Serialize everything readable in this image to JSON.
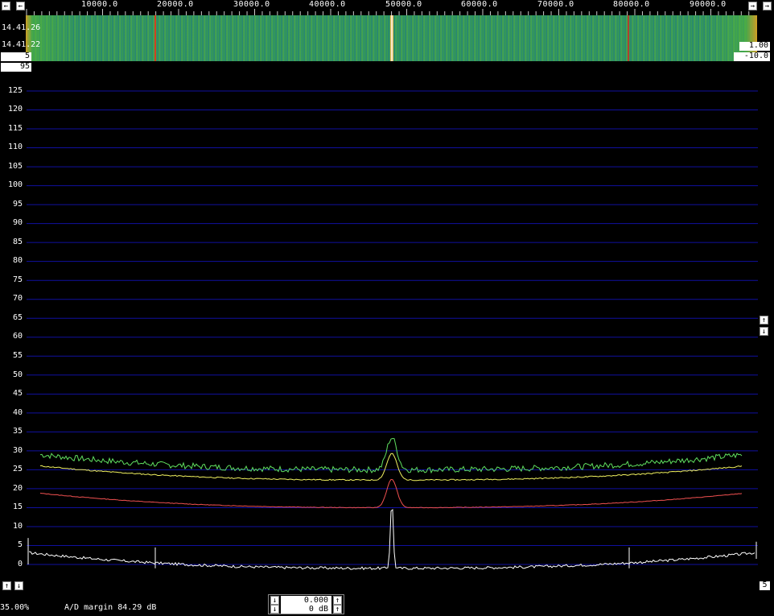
{
  "freq_axis": {
    "labels": [
      "10000.0",
      "20000.0",
      "30000.0",
      "40000.0",
      "50000.0",
      "60000.0",
      "70000.0",
      "80000.0",
      "90000.0"
    ]
  },
  "waterfall": {
    "time_top": "14.41.26",
    "time_bottom": "14.41.22",
    "left_box": "5",
    "right_box_top": "1.00",
    "right_box_bottom": "-10.0",
    "below_box": "95",
    "colors": {
      "noise": "#3aa050",
      "carrier": "#ffffff",
      "spur": "#d04020",
      "edge": "#e0a020"
    }
  },
  "spectrum": {
    "y_labels": [
      "125",
      "120",
      "115",
      "110",
      "105",
      "100",
      "95",
      "90",
      "85",
      "80",
      "75",
      "70",
      "65",
      "60",
      "55",
      "50",
      "45",
      "40",
      "35",
      "30",
      "25",
      "20",
      "15",
      "10",
      "5",
      "0"
    ],
    "corner_box": "5",
    "grid_color": "#1010a0",
    "trace_colors": {
      "green": "#60e060",
      "yellow": "#f0f060",
      "red": "#f05050",
      "white": "#ffffff"
    }
  },
  "buttons": {
    "left_arrow": "←",
    "right_arrow": "→",
    "up_arrow": "↑",
    "down_arrow": "↓"
  },
  "status": {
    "percent": "35.00%",
    "ad_margin": "A/D margin 84.29 dB",
    "value_top": "0.000",
    "value_bottom": "0 dB"
  }
}
